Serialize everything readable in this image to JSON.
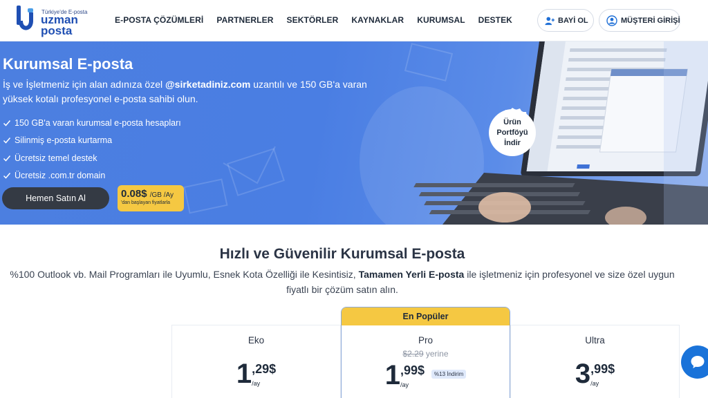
{
  "brand": {
    "tagline": "Türkiye'de E-posta",
    "word1": "uzman",
    "word2": "posta",
    "accent": "#1f4fb3"
  },
  "nav": {
    "items": [
      "E-POSTA ÇÖZÜMLERİ",
      "PARTNERLER",
      "SEKTÖRLER",
      "KAYNAKLAR",
      "KURUMSAL",
      "DESTEK"
    ]
  },
  "header_buttons": {
    "bayi": "BAYİ OL",
    "musteri": "MÜŞTERİ GİRİŞİ"
  },
  "hero": {
    "title": "Kurumsal E-posta",
    "desc_pre": "İş ve İşletmeniz için alan adınıza özel ",
    "desc_domain": "@sirketadiniz.com",
    "desc_post": " uzantılı ve 150 GB'a varan yüksek kotalı profesyonel e-posta sahibi olun.",
    "features": [
      "150 GB'a varan kurumsal e-posta hesapları",
      "Silinmiş e-posta kurtarma",
      "Ücretsiz temel destek",
      "Ücretsiz .com.tr domain"
    ],
    "cta": "Hemen Satın Al",
    "price_value": "0.08$",
    "price_unit": "/GB /Ay",
    "price_note": "'dan başlayan fiyatlarla",
    "portfolio": [
      "Ürün",
      "Portföyü",
      "İndir"
    ],
    "bg_color": "#4a7ee3",
    "badge_color": "#f5c842"
  },
  "section": {
    "title": "Hızlı ve Güvenilir Kurumsal E-posta",
    "desc_pre": "%100 Outlook vb. Mail Programları ile Uyumlu, Esnek Kota Özelliği ile Kesintisiz, ",
    "desc_bold": "Tamamen Yerli E-posta",
    "desc_post": " ile işletmeniz için profesyonel ve size özel uygun fiyatlı bir çözüm satın alın."
  },
  "plans": [
    {
      "name": "Eko",
      "int": "1",
      "dec": ",29$",
      "per": "/ay"
    },
    {
      "name": "Pro",
      "ribbon": "En Popüler",
      "old_price": "$2.29",
      "old_suffix": "yerine",
      "int": "1",
      "dec": ",99$",
      "per": "/ay",
      "discount": "%13 İndirim"
    },
    {
      "name": "Ultra",
      "int": "3",
      "dec": ",99$",
      "per": "/ay"
    }
  ]
}
